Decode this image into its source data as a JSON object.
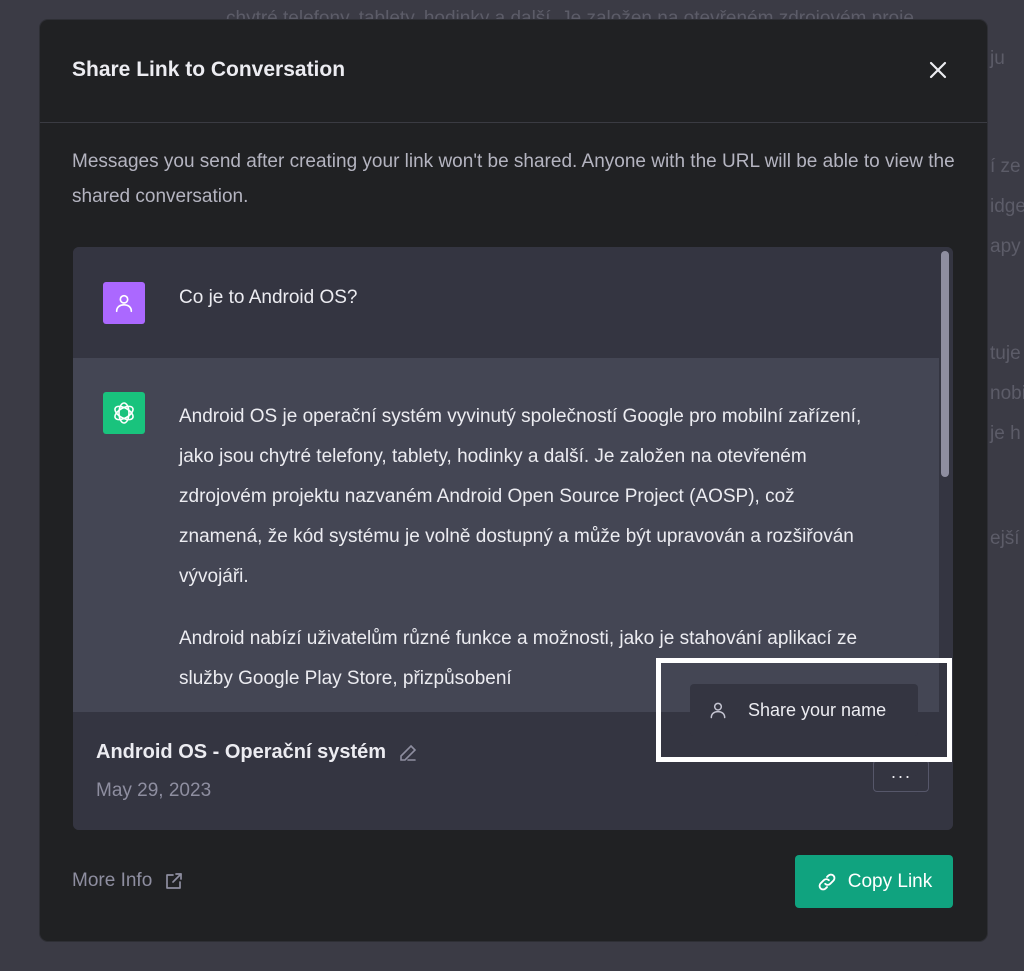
{
  "background": {
    "lines": [
      "chytré telefony, tablety, hodinky a další. Je založen na otevřeném zdrojovém proje",
      "ju",
      "í ze",
      "idge",
      "apy",
      "tuje",
      "nobi",
      "je h",
      "ejší"
    ]
  },
  "modal": {
    "title": "Share Link to Conversation",
    "intro": "Messages you send after creating your link won't be shared. Anyone with the URL will be able to view the shared conversation."
  },
  "preview": {
    "user_message": "Co je to Android OS?",
    "bot_paragraphs": [
      "Android OS je operační systém vyvinutý společností Google pro mobilní zařízení, jako jsou chytré telefony, tablety, hodinky a další. Je založen na otevřeném zdrojovém projektu nazvaném Android Open Source Project (AOSP), což znamená, že kód systému je volně dostupný a může být upravován a rozšiřován vývojáři.",
      "Android nabízí uživatelům různé funkce a možnosti, jako je stahování aplikací ze služby Google Play Store, přizpůsobení"
    ],
    "conversation_title": "Android OS - Operační systém",
    "date": "May 29, 2023",
    "more_label": "···"
  },
  "popover": {
    "label": "Share your name"
  },
  "footer": {
    "more_info": "More Info",
    "copy_link": "Copy Link"
  },
  "colors": {
    "accent": "#10a37f",
    "user_avatar": "#ab68ff",
    "modal_bg": "#202123"
  }
}
